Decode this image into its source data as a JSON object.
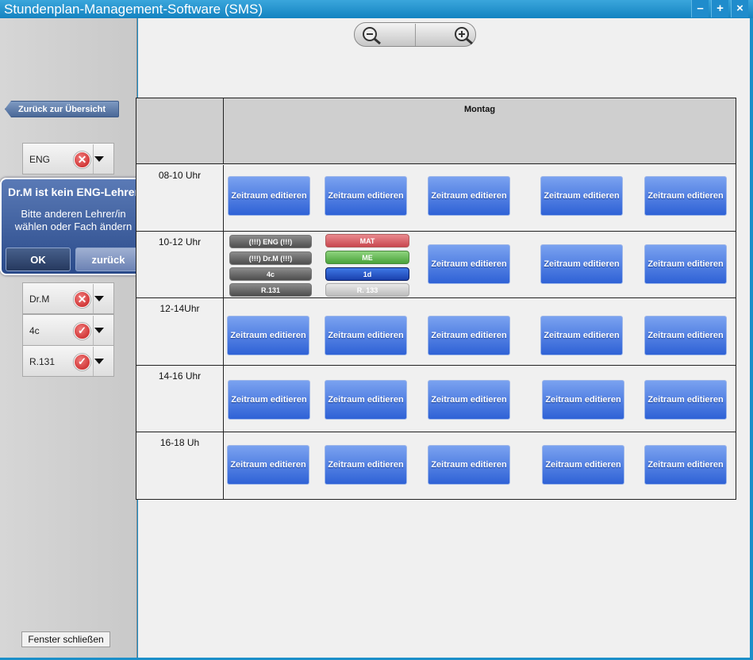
{
  "window": {
    "title": "Stundenplan-Management-Software (SMS)",
    "controls": {
      "minimize": "–",
      "maximize": "+",
      "close": "×"
    }
  },
  "sidebar": {
    "back_label": "Zurück zur Übersicht",
    "selectors": [
      {
        "label": "ENG",
        "status": "error"
      },
      {
        "label": "Dr.M",
        "status": "error"
      },
      {
        "label": "4c",
        "status": "ok"
      },
      {
        "label": "R.131",
        "status": "ok"
      }
    ],
    "close_label": "Fenster schließen"
  },
  "popup": {
    "title": "Dr.M ist kein ENG-Lehrer",
    "message_line1": "Bitte anderen Lehrer/in",
    "message_line2": "wählen oder Fach ändern",
    "ok_label": "OK",
    "back_label": "zurück"
  },
  "zoom": {
    "out_icon": "zoom-out-icon",
    "in_icon": "zoom-in-icon"
  },
  "schedule": {
    "day": "Montag",
    "slots": [
      "08-10 Uhr",
      "10-12 Uhr",
      "12-14Uhr",
      "14-16 Uhr",
      "16-18 Uh"
    ],
    "edit_label": "Zeitraum editieren",
    "booking_pending": {
      "subject": "(!!!) ENG (!!!)",
      "teacher": "(!!!) Dr.M (!!!)",
      "class": "4c",
      "room": "R.131"
    },
    "booking_existing": {
      "subject": "MAT",
      "teacher": "ME",
      "class": "1d",
      "room": "R. 133"
    }
  },
  "colors": {
    "titlebar": "#1b8fc9",
    "edit_button": "#3a6bd8",
    "error": "#c41d1d",
    "mat": "#d9545c",
    "me": "#58b548",
    "class_blue": "#1c4fc8"
  }
}
